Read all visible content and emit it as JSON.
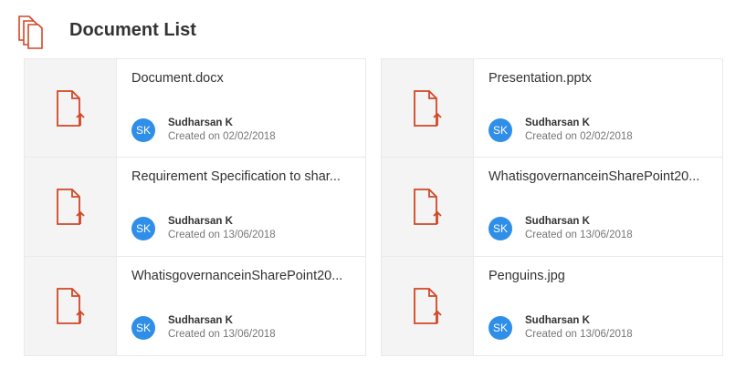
{
  "header": {
    "title": "Document List",
    "icon": "documents-stack-icon"
  },
  "colors": {
    "accent": "#d24726",
    "avatar": "#2f8ee8",
    "thumb_bg": "#f4f4f4",
    "border": "#eaeaea"
  },
  "documents": [
    {
      "title": "Document.docx",
      "initials": "SK",
      "author": "Sudharsan K",
      "created": "Created on 02/02/2018",
      "icon": "document-upload-icon"
    },
    {
      "title": "Presentation.pptx",
      "initials": "SK",
      "author": "Sudharsan K",
      "created": "Created on 02/02/2018",
      "icon": "document-upload-icon"
    },
    {
      "title": "Requirement Specification to shar...",
      "initials": "SK",
      "author": "Sudharsan K",
      "created": "Created on 13/06/2018",
      "icon": "document-upload-icon"
    },
    {
      "title": "WhatisgovernanceinSharePoint20...",
      "initials": "SK",
      "author": "Sudharsan K",
      "created": "Created on 13/06/2018",
      "icon": "document-upload-icon"
    },
    {
      "title": "WhatisgovernanceinSharePoint20...",
      "initials": "SK",
      "author": "Sudharsan K",
      "created": "Created on 13/06/2018",
      "icon": "document-upload-icon"
    },
    {
      "title": "Penguins.jpg",
      "initials": "SK",
      "author": "Sudharsan K",
      "created": "Created on 13/06/2018",
      "icon": "document-upload-icon"
    }
  ]
}
